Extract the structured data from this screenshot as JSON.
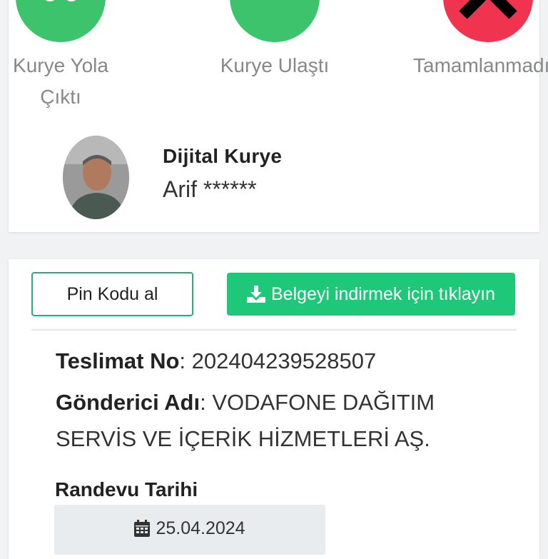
{
  "steps": [
    {
      "label": "Kurye Yola Çıktı",
      "icon": "scooter-icon",
      "color": "#3cc36c"
    },
    {
      "label": "Kurye Ulaştı",
      "icon": "fork-icon",
      "color": "#3cc36c"
    },
    {
      "label": "Tamamlanmadı",
      "icon": "close-icon",
      "color": "#f0344f"
    }
  ],
  "courier": {
    "title": "Dijital Kurye",
    "name": "Arif ******"
  },
  "actions": {
    "pin_label": "Pin Kodu al",
    "download_label": "Belgeyi indirmek için tıklayın",
    "accent": "#1ec878"
  },
  "delivery": {
    "teslimat_label": "Teslimat No",
    "teslimat_value": ": 202404239528507",
    "gonderici_label": "Gönderici Adı",
    "gonderici_value": ": VODAFONE DAĞITIM SERVİS VE İÇERİK HİZMETLERİ AŞ."
  },
  "appointment": {
    "label": "Randevu Tarihi",
    "date": "25.04.2024"
  }
}
